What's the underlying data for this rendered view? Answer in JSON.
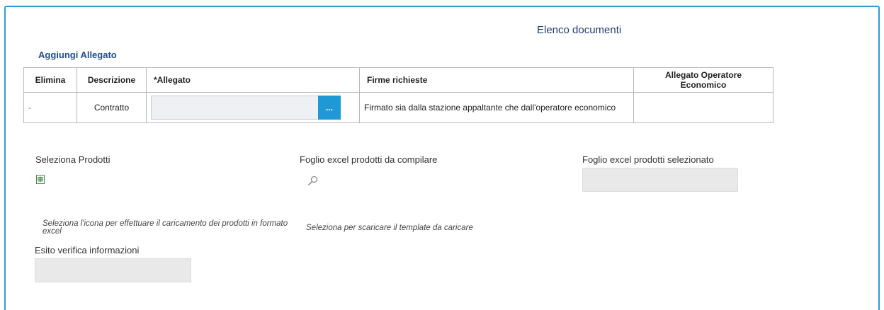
{
  "page": {
    "title": "Elenco documenti",
    "add_attachment_link": "Aggiungi Allegato"
  },
  "table": {
    "headers": [
      "Elimina",
      "Descrizione",
      "*Allegato",
      "Firme richieste",
      "Allegato Operatore Economico"
    ],
    "rows": [
      {
        "elimina": "-",
        "descrizione": "Contratto",
        "allegato_value": "",
        "browse_button": "...",
        "firme": "Firmato sia dalla stazione appaltante che dall'operatore economico",
        "allegato_operatore": ""
      }
    ]
  },
  "products": {
    "select_label": "Seleziona Prodotti",
    "select_icon": "excel-file-icon",
    "select_hint": "Seleziona l'icona per effettuare il caricamento dei prodotti in formato excel",
    "template_label": "Foglio excel prodotti da compilare",
    "template_icon": "search-icon",
    "template_hint": "Seleziona per scaricare il template da caricare",
    "selected_label": "Foglio excel prodotti selezionato",
    "selected_value": ""
  },
  "verification": {
    "label": "Esito verifica informazioni",
    "value": ""
  },
  "colors": {
    "frame_border": "#2e9bd6",
    "title": "#1f3f6e",
    "link": "#1f4e8c",
    "browse_button": "#1f99d6",
    "readonly_field": "#e9e9e9"
  }
}
